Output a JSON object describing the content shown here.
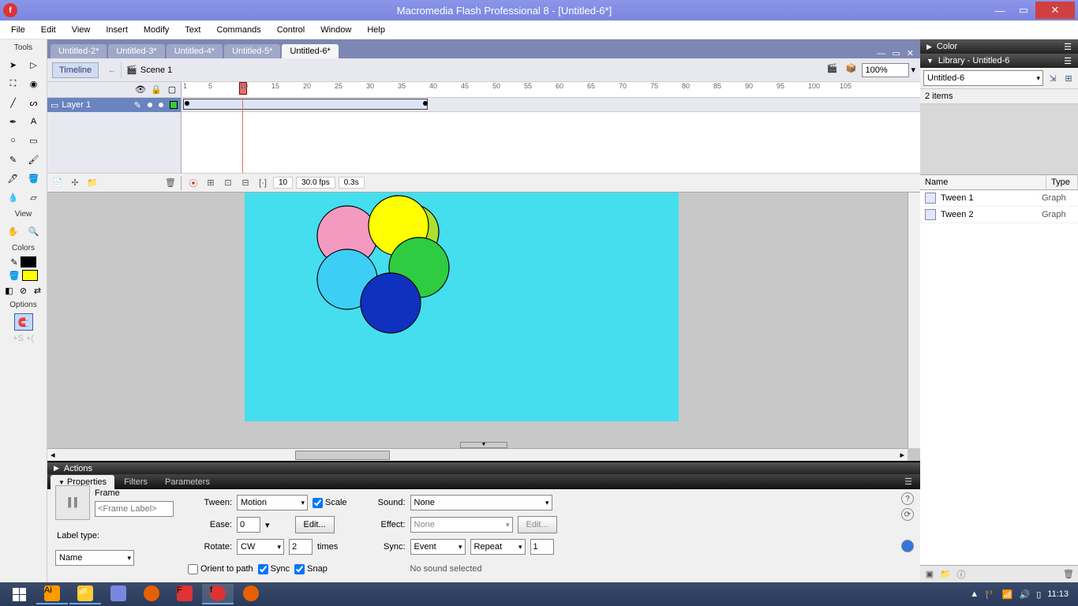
{
  "titlebar": {
    "title": "Macromedia Flash Professional 8 - [Untitled-6*]"
  },
  "menu": [
    "File",
    "Edit",
    "View",
    "Insert",
    "Modify",
    "Text",
    "Commands",
    "Control",
    "Window",
    "Help"
  ],
  "toolbox": {
    "sections": {
      "tools": "Tools",
      "view": "View",
      "colors": "Colors",
      "options": "Options"
    }
  },
  "doctabs": {
    "tabs": [
      "Untitled-2*",
      "Untitled-3*",
      "Untitled-4*",
      "Untitled-5*",
      "Untitled-6*"
    ],
    "active": 4
  },
  "scenebar": {
    "timeline": "Timeline",
    "scene": "Scene 1",
    "zoom": "100%"
  },
  "timeline": {
    "layer": "Layer 1",
    "ticks": [
      1,
      5,
      10,
      15,
      20,
      25,
      30,
      35,
      40,
      45,
      50,
      55,
      60,
      65,
      70,
      75,
      80,
      85,
      90,
      95,
      100,
      105
    ],
    "footer": {
      "frame": "10",
      "fps": "30.0 fps",
      "time": "0.3s"
    },
    "playhead_frame": 10,
    "span_start": 1,
    "span_end": 40
  },
  "actions_panel": "Actions",
  "properties": {
    "tabs": [
      "Properties",
      "Filters",
      "Parameters"
    ],
    "frame_label": "Frame",
    "frame_placeholder": "<Frame Label>",
    "label_type_label": "Label type:",
    "label_type": "Name",
    "tween_label": "Tween:",
    "tween": "Motion",
    "scale_label": "Scale",
    "ease_label": "Ease:",
    "ease": "0",
    "edit_btn": "Edit...",
    "rotate_label": "Rotate:",
    "rotate": "CW",
    "rotate_times": "2",
    "times_label": "times",
    "orient_label": "Orient to path",
    "sync_label": "Sync",
    "snap_label": "Snap",
    "sound_label": "Sound:",
    "sound": "None",
    "effect_label": "Effect:",
    "effect": "None",
    "sync2_label": "Sync:",
    "sync_event": "Event",
    "sync_repeat": "Repeat",
    "sync_count": "1",
    "no_sound": "No sound selected"
  },
  "colorpanel": "Color",
  "library": {
    "title": "Library - Untitled-6",
    "doc": "Untitled-6",
    "count": "2 items",
    "cols": {
      "name": "Name",
      "type": "Type"
    },
    "items": [
      {
        "name": "Tween 1",
        "type": "Graph"
      },
      {
        "name": "Tween 2",
        "type": "Graph"
      }
    ]
  },
  "taskbar": {
    "clock": "11:13"
  }
}
